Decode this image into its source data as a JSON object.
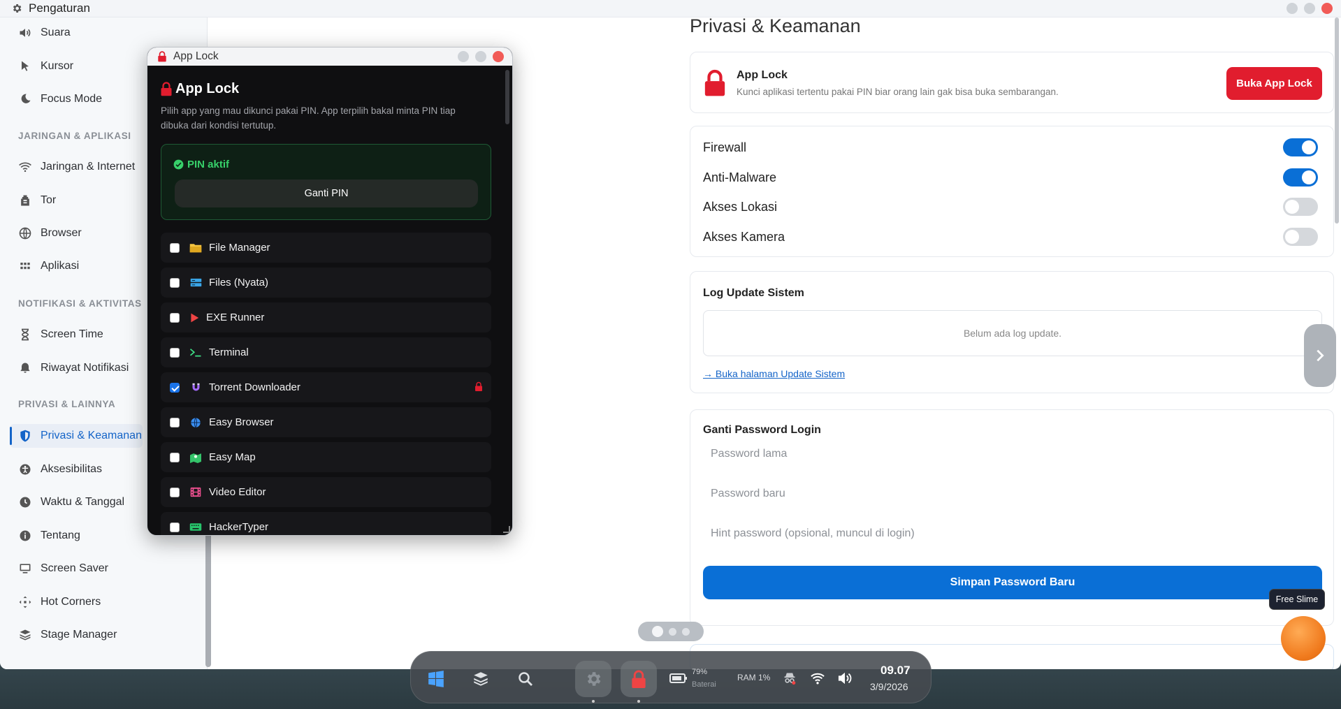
{
  "window": {
    "title": "Pengaturan"
  },
  "sidebar": {
    "items": [
      {
        "label": "Suara",
        "icon": "speaker-icon"
      },
      {
        "label": "Kursor",
        "icon": "cursor-icon"
      },
      {
        "label": "Focus Mode",
        "icon": "moon-icon"
      },
      {
        "label": "Jaringan & Internet",
        "icon": "wifi-icon"
      },
      {
        "label": "Tor",
        "icon": "onion-icon"
      },
      {
        "label": "Browser",
        "icon": "globe-icon"
      },
      {
        "label": "Aplikasi",
        "icon": "grid-icon"
      },
      {
        "label": "Screen Time",
        "icon": "hourglass-icon"
      },
      {
        "label": "Riwayat Notifikasi",
        "icon": "bell-icon"
      },
      {
        "label": "Privasi & Keamanan",
        "icon": "shield-icon",
        "active": true
      },
      {
        "label": "Aksesibilitas",
        "icon": "accessibility-icon"
      },
      {
        "label": "Waktu & Tanggal",
        "icon": "clock-icon"
      },
      {
        "label": "Tentang",
        "icon": "info-icon"
      },
      {
        "label": "Screen Saver",
        "icon": "monitor-icon"
      },
      {
        "label": "Hot Corners",
        "icon": "corners-icon"
      },
      {
        "label": "Stage Manager",
        "icon": "layers-icon"
      }
    ],
    "sections": {
      "network": "JARINGAN & APLIKASI",
      "notifications": "NOTIFIKASI & AKTIVITAS",
      "privacy": "PRIVASI & LAINNYA"
    }
  },
  "main": {
    "title": "Privasi & Keamanan",
    "applock": {
      "title": "App Lock",
      "description": "Kunci aplikasi tertentu pakai PIN biar orang lain gak bisa buka sembarangan.",
      "button": "Buka App Lock"
    },
    "toggles": [
      {
        "label": "Firewall",
        "on": true
      },
      {
        "label": "Anti-Malware",
        "on": true
      },
      {
        "label": "Akses Lokasi",
        "on": false
      },
      {
        "label": "Akses Kamera",
        "on": false
      }
    ],
    "log": {
      "title": "Log Update Sistem",
      "empty": "Belum ada log update.",
      "link": "→ Buka halaman Update Sistem"
    },
    "password": {
      "title": "Ganti Password Login",
      "old_placeholder": "Password lama",
      "new_placeholder": "Password baru",
      "hint_placeholder": "Hint password (opsional, muncul di login)",
      "save_button": "Simpan Password Baru"
    },
    "free_slime": "Free Slime"
  },
  "applock_window": {
    "title": "App Lock",
    "heading": "App Lock",
    "description": "Pilih app yang mau dikunci pakai PIN. App terpilih bakal minta PIN tiap dibuka dari kondisi tertutup.",
    "pin_status": "PIN aktif",
    "change_pin": "Ganti PIN",
    "apps": [
      {
        "label": "File Manager",
        "icon": "folder-icon",
        "checked": false
      },
      {
        "label": "Files (Nyata)",
        "icon": "drive-icon",
        "checked": false
      },
      {
        "label": "EXE Runner",
        "icon": "play-icon",
        "checked": false
      },
      {
        "label": "Terminal",
        "icon": "terminal-icon",
        "checked": false
      },
      {
        "label": "Torrent Downloader",
        "icon": "magnet-icon",
        "checked": true,
        "locked": true
      },
      {
        "label": "Easy Browser",
        "icon": "globe-icon",
        "checked": false
      },
      {
        "label": "Easy Map",
        "icon": "map-icon",
        "checked": false
      },
      {
        "label": "Video Editor",
        "icon": "film-icon",
        "checked": false
      },
      {
        "label": "HackerTyper",
        "icon": "keyboard-icon",
        "checked": false
      }
    ]
  },
  "taskbar": {
    "battery_percent": "79%",
    "battery_label": "Baterai",
    "ram": "RAM 1%",
    "time": "09.07",
    "date": "3/9/2026"
  },
  "colors": {
    "accent_blue": "#0a6fd6",
    "accent_red": "#e11d2e",
    "pin_green": "#37d06a"
  }
}
